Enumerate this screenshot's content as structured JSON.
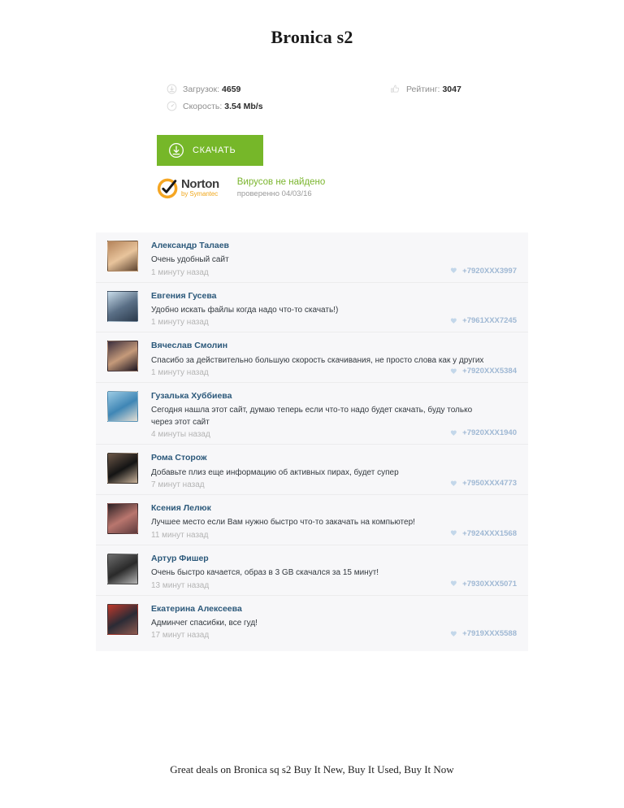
{
  "page": {
    "title": "Bronica s2",
    "footer_text": "Great deals on Bronica sq s2 Buy It New, Buy It Used, Buy It Now"
  },
  "stats": {
    "downloads": {
      "icon": "download-circle-icon",
      "label": "Загрузок:",
      "value": "4659"
    },
    "rating": {
      "icon": "thumbs-up-icon",
      "label": "Рейтинг:",
      "value": "3047"
    },
    "speed": {
      "icon": "speedometer-icon",
      "label": "Скорость:",
      "value": "3.54 Mb/s"
    }
  },
  "download_button": {
    "label": "СКАЧАТЬ",
    "icon": "download-circle-icon",
    "color": "#76b729"
  },
  "norton": {
    "brand": "Norton",
    "sub_brand": "by Symantec",
    "shield_icon": "norton-checkmark-shield-icon",
    "status": "Вирусов не найдено",
    "checked": "проверенно 04/03/16",
    "status_color": "#7bb52e",
    "brand_color": "#f0a81e"
  },
  "comments": [
    {
      "author": "Александр Талаев",
      "text": "Очень удобный сайт",
      "time": "1 минуту назад",
      "phone": "+7920XXX3997",
      "avatar_colors": [
        "#b4835a",
        "#e8c49c",
        "#5e4430"
      ]
    },
    {
      "author": "Евгения Гусева",
      "text": "Удобно искать файлы когда надо что-то скачать!)",
      "time": "1 минуту назад",
      "phone": "+7961XXX7245",
      "avatar_colors": [
        "#c8dcea",
        "#5a6f86",
        "#2b3a4c"
      ]
    },
    {
      "author": "Вячеслав Смолин",
      "text": "Спасибо за действительно большую скорость скачивания, не просто слова как у других",
      "time": "1 минуту назад",
      "phone": "+7920XXX5384",
      "avatar_colors": [
        "#3a2d3d",
        "#c59a7a",
        "#1b1420"
      ]
    },
    {
      "author": "Гузалька Хуббиева",
      "text": "Сегодня нашла этот сайт, думаю теперь если что-то надо будет скачать, буду только через этот сайт",
      "time": "4 минуты назад",
      "phone": "+7920XXX1940",
      "avatar_colors": [
        "#9ccbe4",
        "#3f86b5",
        "#e7e0d4"
      ]
    },
    {
      "author": "Рома Сторож",
      "text": "Добавьте плиз еще информацию об активных пирах, будет супер",
      "time": "7 минут назад",
      "phone": "+7950XXX4773",
      "avatar_colors": [
        "#6d5848",
        "#141414",
        "#cbb49c"
      ]
    },
    {
      "author": "Ксения Лелюк",
      "text": "Лучшее место если Вам нужно быстро что-то закачать на компьютер!",
      "time": "11 минут назад",
      "phone": "+7924XXX1568",
      "avatar_colors": [
        "#2a2024",
        "#b9766e",
        "#5d3a3c"
      ]
    },
    {
      "author": "Артур Фишер",
      "text": "Очень быстро качается, образ в 3 GB скачался за 15 минут!",
      "time": "13 минут назад",
      "phone": "+7930XXX5071",
      "avatar_colors": [
        "#6e6e6e",
        "#2a2a2a",
        "#b5b5b5"
      ]
    },
    {
      "author": "Екатерина Алексеева",
      "text": "Админчег спасибки, все гуд!",
      "time": "17 минут назад",
      "phone": "+7919XXX5588",
      "avatar_colors": [
        "#c0392b",
        "#2b2b35",
        "#8e5a50"
      ]
    }
  ]
}
